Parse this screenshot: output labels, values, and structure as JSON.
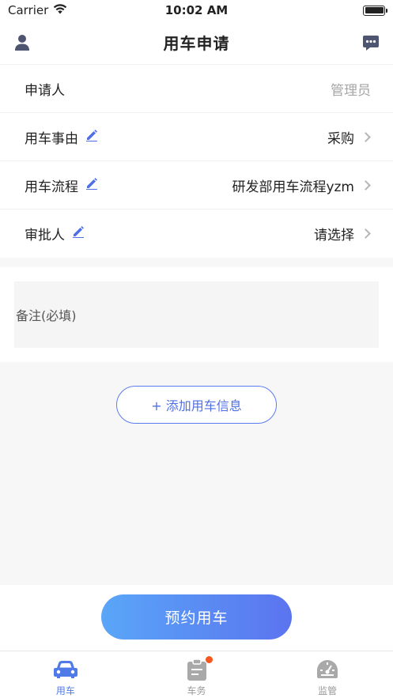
{
  "status_bar": {
    "carrier": "Carrier",
    "time": "10:02 AM"
  },
  "header": {
    "title": "用车申请",
    "left_icon": "user-icon",
    "right_icon": "chat-icon"
  },
  "form": {
    "applicant": {
      "label": "申请人",
      "value": "管理员"
    },
    "reason": {
      "label": "用车事由",
      "value": "采购"
    },
    "process": {
      "label": "用车流程",
      "value": "研发部用车流程yzm"
    },
    "approver": {
      "label": "审批人",
      "value": "请选择"
    }
  },
  "notes": {
    "placeholder": "备注(必填)"
  },
  "add_button": {
    "label": "+ 添加用车信息"
  },
  "book_button": {
    "label": "预约用车"
  },
  "tabs": [
    {
      "label": "用车",
      "icon": "car-icon",
      "active": true
    },
    {
      "label": "车务",
      "icon": "clipboard-icon",
      "badge": true
    },
    {
      "label": "监管",
      "icon": "gauge-icon"
    }
  ],
  "colors": {
    "accent": "#4f7be8",
    "gradient_start": "#5aa6f8",
    "gradient_end": "#5b74ef",
    "badge": "#f5571e"
  }
}
